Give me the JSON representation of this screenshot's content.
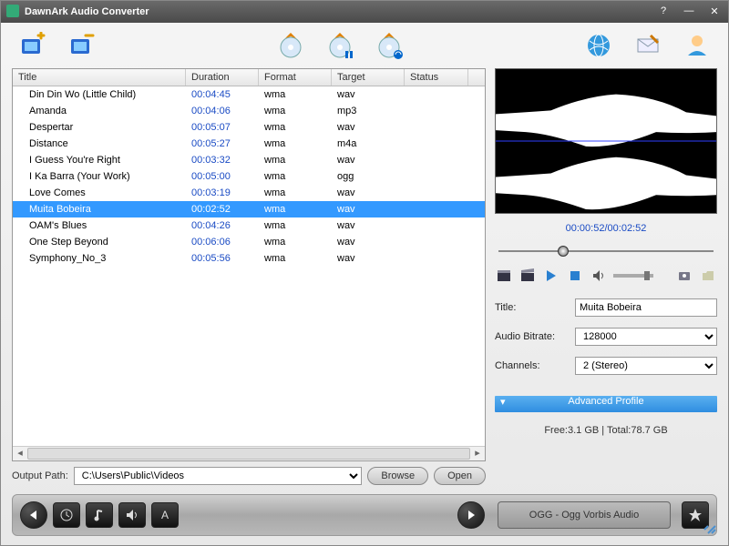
{
  "window": {
    "title": "DawnArk Audio Converter"
  },
  "columns": {
    "title": "Title",
    "duration": "Duration",
    "format": "Format",
    "target": "Target",
    "status": "Status"
  },
  "tracks": [
    {
      "title": "Din Din Wo (Little Child)",
      "duration": "00:04:45",
      "format": "wma",
      "target": "wav",
      "status": ""
    },
    {
      "title": "Amanda",
      "duration": "00:04:06",
      "format": "wma",
      "target": "mp3",
      "status": ""
    },
    {
      "title": "Despertar",
      "duration": "00:05:07",
      "format": "wma",
      "target": "wav",
      "status": ""
    },
    {
      "title": "Distance",
      "duration": "00:05:27",
      "format": "wma",
      "target": "m4a",
      "status": ""
    },
    {
      "title": "I Guess You're Right",
      "duration": "00:03:32",
      "format": "wma",
      "target": "wav",
      "status": ""
    },
    {
      "title": "I Ka Barra (Your Work)",
      "duration": "00:05:00",
      "format": "wma",
      "target": "ogg",
      "status": ""
    },
    {
      "title": "Love Comes",
      "duration": "00:03:19",
      "format": "wma",
      "target": "wav",
      "status": ""
    },
    {
      "title": "Muita Bobeira",
      "duration": "00:02:52",
      "format": "wma",
      "target": "wav",
      "status": ""
    },
    {
      "title": "OAM's Blues",
      "duration": "00:04:26",
      "format": "wma",
      "target": "wav",
      "status": ""
    },
    {
      "title": "One Step Beyond",
      "duration": "00:06:06",
      "format": "wma",
      "target": "wav",
      "status": ""
    },
    {
      "title": "Symphony_No_3",
      "duration": "00:05:56",
      "format": "wma",
      "target": "wav",
      "status": ""
    }
  ],
  "selected_index": 7,
  "output": {
    "label": "Output Path:",
    "path": "C:\\Users\\Public\\Videos",
    "browse": "Browse",
    "open": "Open"
  },
  "playback": {
    "position": "00:00:52",
    "duration": "00:02:52",
    "progress_pct": 30
  },
  "details": {
    "title_label": "Title:",
    "title_value": "Muita Bobeira",
    "bitrate_label": "Audio Bitrate:",
    "bitrate_value": "128000",
    "channels_label": "Channels:",
    "channels_value": "2 (Stereo)"
  },
  "advanced_profile_label": "Advanced Profile",
  "storage": {
    "free_label": "Free:",
    "free_value": "3.1 GB",
    "sep": " | ",
    "total_label": "Total:",
    "total_value": "78.7 GB"
  },
  "profile": {
    "current": "OGG - Ogg Vorbis Audio"
  }
}
